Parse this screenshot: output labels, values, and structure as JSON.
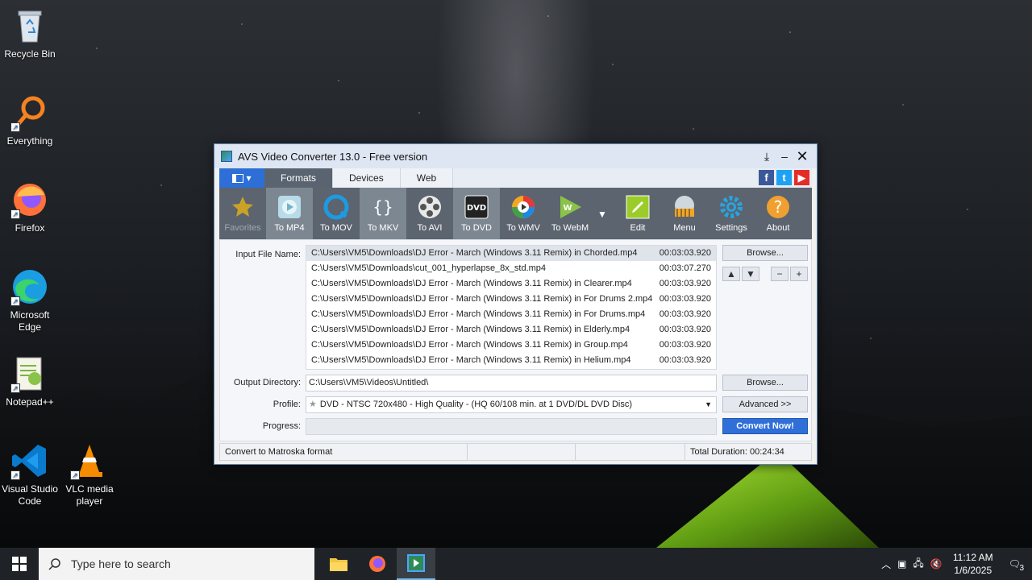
{
  "desktop": {
    "icons": [
      {
        "label": "Recycle Bin"
      },
      {
        "label": "Everything"
      },
      {
        "label": "Firefox"
      },
      {
        "label": "Microsoft Edge"
      },
      {
        "label": "Notepad++"
      },
      {
        "label": "Visual Studio Code"
      },
      {
        "label": "VLC media player"
      }
    ]
  },
  "window": {
    "title": "AVS Video Converter 13.0 - Free version",
    "tabs": [
      {
        "label": "Formats"
      },
      {
        "label": "Devices"
      },
      {
        "label": "Web"
      }
    ],
    "toolbar": [
      {
        "label": "Favorites",
        "icon": "star-icon"
      },
      {
        "label": "To MP4",
        "icon": "mp4-icon"
      },
      {
        "label": "To MOV",
        "icon": "mov-icon"
      },
      {
        "label": "To MKV",
        "icon": "mkv-icon"
      },
      {
        "label": "To AVI",
        "icon": "avi-icon"
      },
      {
        "label": "To DVD",
        "icon": "dvd-icon"
      },
      {
        "label": "To WMV",
        "icon": "wmv-icon"
      },
      {
        "label": "To WebM",
        "icon": "webm-icon"
      },
      {
        "label": "Edit",
        "icon": "edit-icon"
      },
      {
        "label": "Menu",
        "icon": "menu-icon"
      },
      {
        "label": "Settings",
        "icon": "gear-icon"
      },
      {
        "label": "About",
        "icon": "help-icon"
      }
    ],
    "input_label": "Input File Name:",
    "files": [
      {
        "path": "C:\\Users\\VM5\\Downloads\\DJ Error - March (Windows 3.11 Remix) in Chorded.mp4",
        "duration": "00:03:03.920"
      },
      {
        "path": "C:\\Users\\VM5\\Downloads\\cut_001_hyperlapse_8x_std.mp4",
        "duration": "00:03:07.270"
      },
      {
        "path": "C:\\Users\\VM5\\Downloads\\DJ Error - March (Windows 3.11 Remix) in Clearer.mp4",
        "duration": "00:03:03.920"
      },
      {
        "path": "C:\\Users\\VM5\\Downloads\\DJ Error - March (Windows 3.11 Remix) in For Drums 2.mp4",
        "duration": "00:03:03.920"
      },
      {
        "path": "C:\\Users\\VM5\\Downloads\\DJ Error - March (Windows 3.11 Remix) in For Drums.mp4",
        "duration": "00:03:03.920"
      },
      {
        "path": "C:\\Users\\VM5\\Downloads\\DJ Error - March (Windows 3.11 Remix) in Elderly.mp4",
        "duration": "00:03:03.920"
      },
      {
        "path": "C:\\Users\\VM5\\Downloads\\DJ Error - March (Windows 3.11 Remix) in Group.mp4",
        "duration": "00:03:03.920"
      },
      {
        "path": "C:\\Users\\VM5\\Downloads\\DJ Error - March (Windows 3.11 Remix) in Helium.mp4",
        "duration": "00:03:03.920"
      }
    ],
    "browse_label": "Browse...",
    "output_label": "Output Directory:",
    "output_value": "C:\\Users\\VM5\\Videos\\Untitled\\",
    "profile_label": "Profile:",
    "profile_value": "DVD - NTSC 720x480 - High Quality - (HQ 60/108 min. at 1 DVD/DL DVD Disc)",
    "advanced_label": "Advanced >>",
    "progress_label": "Progress:",
    "progress_value": 0,
    "convert_label": "Convert Now!",
    "status_text": "Convert to Matroska format",
    "total_duration": "Total Duration: 00:24:34"
  },
  "taskbar": {
    "search_placeholder": "Type here to search",
    "time": "11:12 AM",
    "date": "1/6/2025",
    "notification_count": "3"
  },
  "colors": {
    "accent": "#2f6fd7",
    "toolbar_bg": "#5b646f",
    "active_tab": "#5a6470"
  }
}
